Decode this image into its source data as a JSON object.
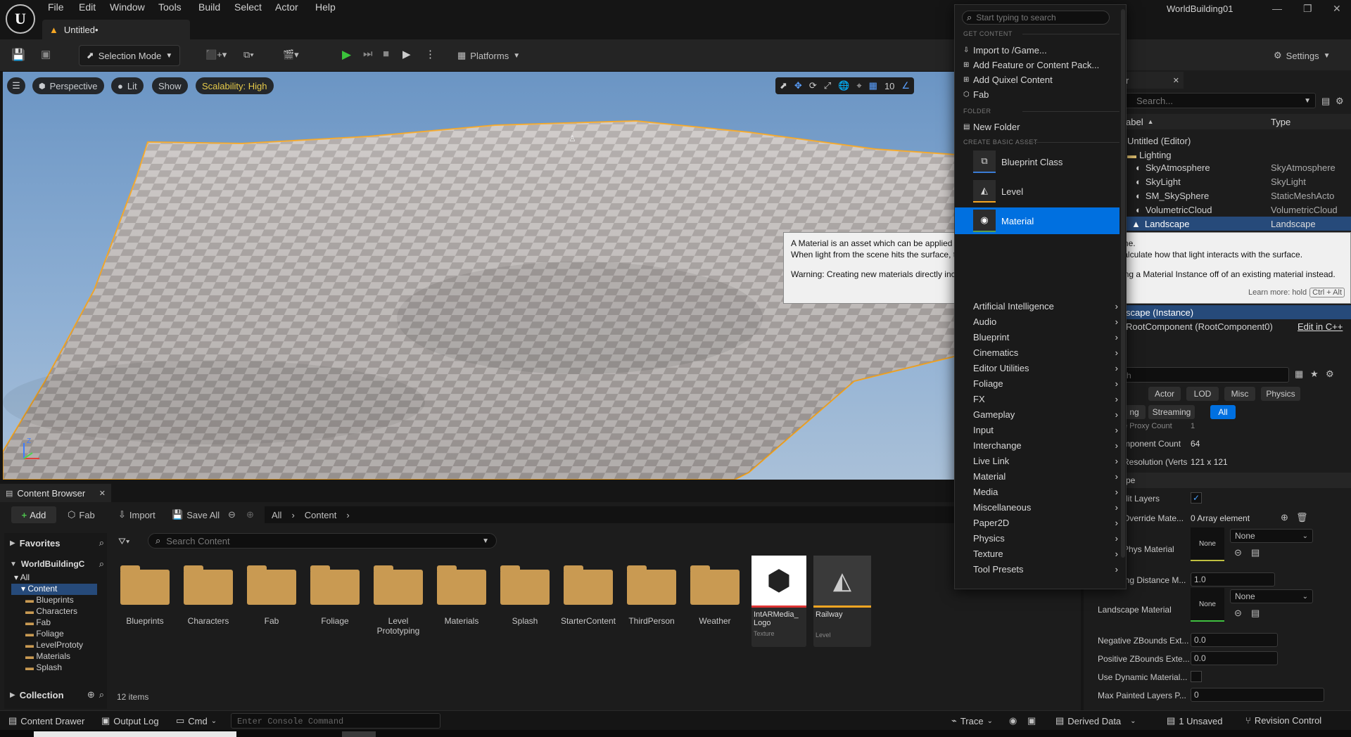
{
  "title_bar": {
    "menus": [
      "File",
      "Edit",
      "Window",
      "Tools",
      "Build",
      "Select",
      "Actor",
      "Help"
    ],
    "tab_label": "Untitled•",
    "project_name": "WorldBuilding01"
  },
  "toolbar": {
    "selection_mode": "Selection Mode",
    "platforms": "Platforms",
    "settings": "Settings"
  },
  "viewport": {
    "perspective": "Perspective",
    "lit": "Lit",
    "show": "Show",
    "scalability": "Scalability: High",
    "grid_size": "10",
    "axis_z": "Z",
    "axis_x": "X"
  },
  "context_menu": {
    "search_placeholder": "Start typing to search",
    "sections": {
      "get_content": "GET CONTENT",
      "folder": "FOLDER",
      "create_basic_asset": "CREATE BASIC ASSET"
    },
    "get_content_items": [
      "Import to /Game...",
      "Add Feature or Content Pack...",
      "Add Quixel Content",
      "Fab"
    ],
    "folder_items": [
      "New Folder"
    ],
    "basic_assets": [
      "Blueprint Class",
      "Level",
      "Material"
    ],
    "categories": [
      "Artificial Intelligence",
      "Audio",
      "Blueprint",
      "Cinematics",
      "Editor Utilities",
      "Foliage",
      "FX",
      "Gameplay",
      "Input",
      "Interchange",
      "Live Link",
      "Material",
      "Media",
      "Miscellaneous",
      "Paper2D",
      "Physics",
      "Texture",
      "Tool Presets"
    ]
  },
  "tooltip": {
    "line1": "A Material is an asset which can be applied to a mesh to control the visual look of the scene.",
    "line2": "When light from the scene hits the surface, the shading model of the material is used to calculate how that light interacts with the surface.",
    "warning": "Warning: Creating new materials directly increases shader compile times!  Consider creating a Material Instance off of an existing material instead.",
    "learn_more": "Learn more: hold",
    "shortcut": "Ctrl + Alt"
  },
  "outliner": {
    "tab_suffix": "r",
    "search_placeholder": "Search...",
    "col_label": "abel",
    "col_type": "Type",
    "root": "Untitled (Editor)",
    "folder": "Lighting",
    "rows": [
      {
        "label": "SkyAtmosphere",
        "type": "SkyAtmosphere"
      },
      {
        "label": "SkyLight",
        "type": "SkyLight"
      },
      {
        "label": "SM_SkySphere",
        "type": "StaticMeshActo"
      },
      {
        "label": "VolumetricCloud",
        "type": "VolumetricCloud"
      },
      {
        "label": "Landscape",
        "type": "Landscape"
      }
    ]
  },
  "details": {
    "instance_label": "scape (Instance)",
    "root_component": "RootComponent (RootComponent0)",
    "edit_cpp": "Edit in C++",
    "search_partial": "h",
    "filter_tabs": [
      "Actor",
      "LOD",
      "Misc",
      "Physics"
    ],
    "filter_tabs2": [
      "ng",
      "Streaming",
      "All"
    ],
    "props": [
      {
        "label": "e Proxy Count",
        "value": "1"
      },
      {
        "label": "mponent Count",
        "value": "64"
      },
      {
        "label": "Resolution (Verts",
        "value": "121 x 121"
      }
    ],
    "section_label": "pe",
    "edit_layers": "dit Layers",
    "override_mat": "Override Mate...",
    "override_value": "0 Array element",
    "phys_material": "Phys Material",
    "none": "None",
    "lod_distance": "ing Distance M...",
    "lod_value": "1.0",
    "landscape_material": "Landscape Material",
    "neg_z": "Negative ZBounds Ext...",
    "neg_z_value": "0.0",
    "pos_z": "Positive ZBounds Exte...",
    "pos_z_value": "0.0",
    "dyn_mat": "Use Dynamic Material...",
    "max_painted": "Max Painted Layers P...",
    "max_painted_value": "0"
  },
  "content_browser": {
    "tab": "Content Browser",
    "add": "Add",
    "fab": "Fab",
    "import": "Import",
    "save_all": "Save All",
    "breadcrumb": [
      "All",
      "Content"
    ],
    "favorites": "Favorites",
    "project": "WorldBuildingC",
    "tree": [
      "All",
      "Content",
      "Blueprints",
      "Characters",
      "Fab",
      "Foliage",
      "LevelPrototy",
      "Materials",
      "Splash"
    ],
    "collection": "Collection",
    "search_placeholder": "Search Content",
    "folders": [
      "Blueprints",
      "Characters",
      "Fab",
      "Foliage",
      "Level Prototyping",
      "Materials",
      "Splash",
      "StarterContent",
      "ThirdPerson",
      "Weather"
    ],
    "assets": [
      {
        "name": "IntARMedia_ Logo",
        "type": "Texture"
      },
      {
        "name": "Railway",
        "type": "Level"
      }
    ],
    "item_count": "12 items"
  },
  "status_bar": {
    "content_drawer": "Content Drawer",
    "output_log": "Output Log",
    "cmd": "Cmd",
    "console_placeholder": "Enter Console Command",
    "trace": "Trace",
    "derived_data": "Derived Data",
    "unsaved": "1 Unsaved",
    "revision_control": "Revision Control"
  },
  "colors": {
    "accent": "#0070e0",
    "highlight_row": "#264a7a",
    "orange_outline": "#f5a623",
    "folder": "#c99a52"
  }
}
